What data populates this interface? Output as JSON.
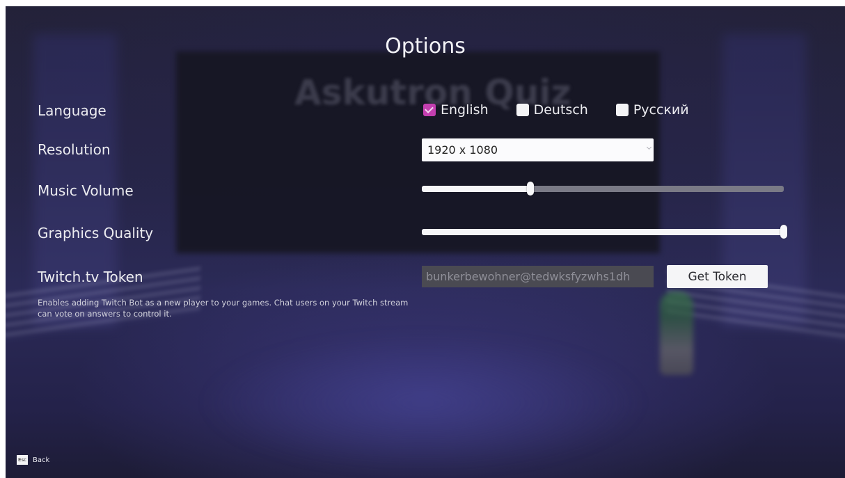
{
  "background": {
    "scene_title": "Askutron Quiz"
  },
  "title": "Options",
  "language": {
    "label": "Language",
    "options": [
      {
        "label": "English",
        "checked": true
      },
      {
        "label": "Deutsch",
        "checked": false
      },
      {
        "label": "Русский",
        "checked": false
      }
    ]
  },
  "resolution": {
    "label": "Resolution",
    "value": "1920 x 1080"
  },
  "music_volume": {
    "label": "Music Volume",
    "level": 0.3
  },
  "graphics_quality": {
    "label": "Graphics Quality",
    "level": 1.0
  },
  "twitch": {
    "label": "Twitch.tv Token",
    "token_value": "bunkerbewohner@tedwksfyzwhs1dh",
    "button_label": "Get Token",
    "help": "Enables adding Twitch Bot as a new player to your games. Chat users on your Twitch stream can vote on answers to control it."
  },
  "footer": {
    "key": "Esc",
    "back_label": "Back"
  },
  "colors": {
    "accent": "#c43fb0"
  }
}
